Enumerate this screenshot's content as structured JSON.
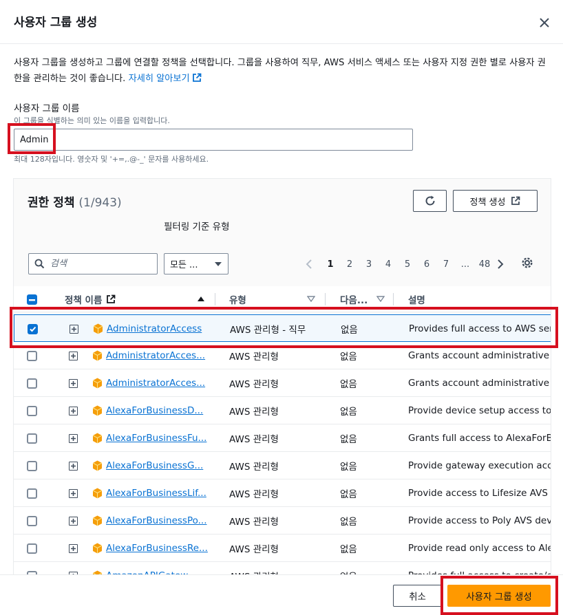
{
  "dialog": {
    "title": "사용자 그룹 생성",
    "description": "사용자 그룹을 생성하고 그룹에 연결할 정책을 선택합니다. 그룹을 사용하여 직무, AWS 서비스 액세스 또는 사용자 지정 권한 별로 사용자 권한을 관리하는 것이 좋습니다.",
    "learn_more": "자세히 알아보기"
  },
  "group_name": {
    "label": "사용자 그룹 이름",
    "hint": "이 그룹을 식별하는 의미 있는 이름을 입력합니다.",
    "value": "Admin",
    "constraint": "최대 128자입니다. 영숫자 및 '+=,.@-_' 문자를 사용하세요."
  },
  "policies": {
    "title": "권한 정책",
    "count": "(1/943)",
    "create_button": "정책 생성",
    "filter_label": "필터링 기준 유형",
    "search_placeholder": "검색",
    "type_select": "모든 ...",
    "pages": [
      "1",
      "2",
      "3",
      "4",
      "5",
      "6",
      "7",
      "...",
      "48"
    ],
    "columns": {
      "name": "정책 이름",
      "type": "유형",
      "used_as": "다음...",
      "description": "설명"
    },
    "rows": [
      {
        "name": "AdministratorAccess",
        "type": "AWS 관리형 - 직무",
        "used_as": "없음",
        "description": "Provides full access to AWS services",
        "checked": true
      },
      {
        "name": "AdministratorAcces...",
        "type": "AWS 관리형",
        "used_as": "없음",
        "description": "Grants account administrative permissions",
        "checked": false
      },
      {
        "name": "AdministratorAcces...",
        "type": "AWS 관리형",
        "used_as": "없음",
        "description": "Grants account administrative permissions",
        "checked": false
      },
      {
        "name": "AlexaForBusinessD...",
        "type": "AWS 관리형",
        "used_as": "없음",
        "description": "Provide device setup access to AlexaForBusiness",
        "checked": false
      },
      {
        "name": "AlexaForBusinessFu...",
        "type": "AWS 관리형",
        "used_as": "없음",
        "description": "Grants full access to AlexaForBusiness",
        "checked": false
      },
      {
        "name": "AlexaForBusinessG...",
        "type": "AWS 관리형",
        "used_as": "없음",
        "description": "Provide gateway execution access",
        "checked": false
      },
      {
        "name": "AlexaForBusinessLif...",
        "type": "AWS 관리형",
        "used_as": "없음",
        "description": "Provide access to Lifesize AVS devices",
        "checked": false
      },
      {
        "name": "AlexaForBusinessPo...",
        "type": "AWS 관리형",
        "used_as": "없음",
        "description": "Provide access to Poly AVS devices",
        "checked": false
      },
      {
        "name": "AlexaForBusinessRe...",
        "type": "AWS 관리형",
        "used_as": "없음",
        "description": "Provide read only access to Alexa",
        "checked": false
      },
      {
        "name": "AmazonAPIGatew...",
        "type": "AWS 관리형",
        "used_as": "없음",
        "description": "Provides full access to create/edit",
        "checked": false
      }
    ]
  },
  "footer": {
    "cancel": "취소",
    "create": "사용자 그룹 생성"
  },
  "colors": {
    "accent": "#0972d3",
    "primary_button": "#ff9900",
    "highlight": "#d6101f"
  }
}
